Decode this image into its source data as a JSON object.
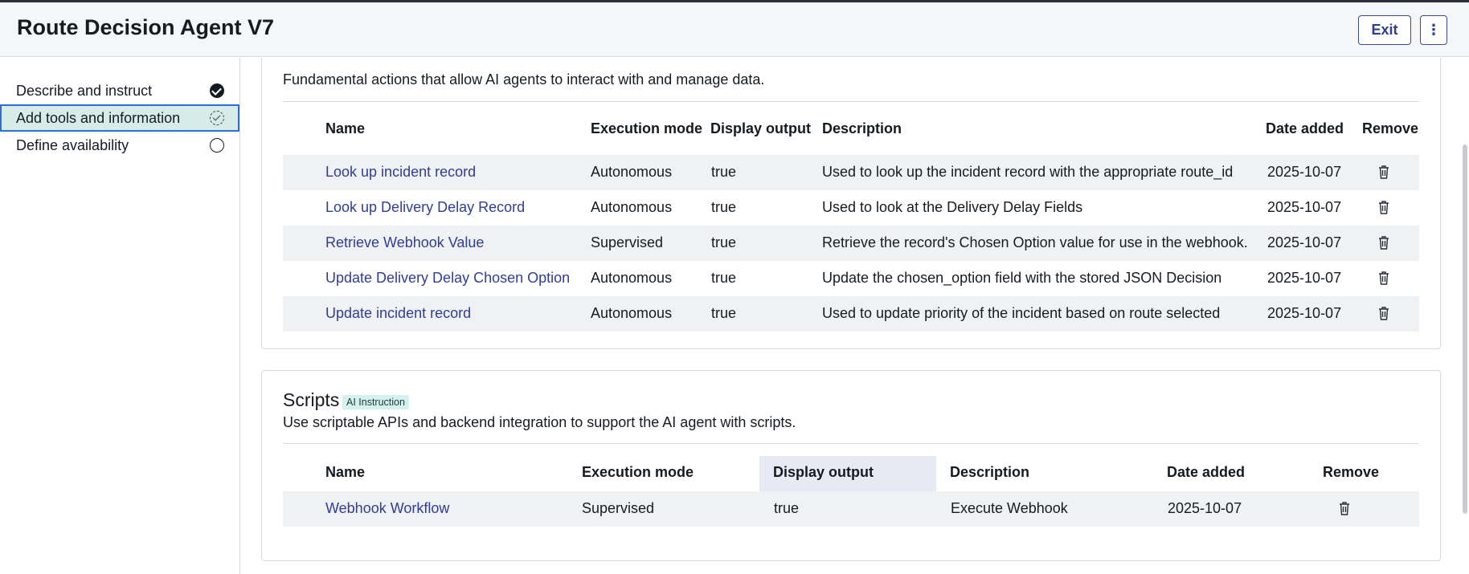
{
  "header": {
    "title": "Route Decision Agent V7",
    "exit_label": "Exit",
    "more_label": "⋮"
  },
  "sidebar": {
    "items": [
      {
        "label": "Describe and instruct",
        "status": "done"
      },
      {
        "label": "Add tools and information",
        "status": "in-progress"
      },
      {
        "label": "Define availability",
        "status": "not-started"
      }
    ]
  },
  "tools_card": {
    "description": "Fundamental actions that allow AI agents to interact with and manage data.",
    "columns": [
      "Name",
      "Execution mode",
      "Display output",
      "Description",
      "Date added",
      "Remove"
    ],
    "rows": [
      {
        "name": "Look up incident record",
        "mode": "Autonomous",
        "output": "true",
        "description": "Used to look up the incident record with the appropriate route_id",
        "date": "2025-10-07"
      },
      {
        "name": "Look up Delivery Delay Record",
        "mode": "Autonomous",
        "output": "true",
        "description": "Used to look at the Delivery Delay Fields",
        "date": "2025-10-07"
      },
      {
        "name": "Retrieve Webhook Value",
        "mode": "Supervised",
        "output": "true",
        "description": "Retrieve the record's Chosen Option value for use in the webhook.",
        "date": "2025-10-07"
      },
      {
        "name": "Update Delivery Delay Chosen Option",
        "mode": "Autonomous",
        "output": "true",
        "description": "Update the chosen_option field with the stored JSON Decision",
        "date": "2025-10-07"
      },
      {
        "name": "Update incident record",
        "mode": "Autonomous",
        "output": "true",
        "description": "Used to update priority of the incident based on route selected",
        "date": "2025-10-07"
      }
    ]
  },
  "scripts_card": {
    "title": "Scripts",
    "badge": "AI Instruction",
    "description": "Use scriptable APIs and backend integration to support the AI agent with scripts.",
    "columns": [
      "Name",
      "Execution mode",
      "Display output",
      "Description",
      "Date added",
      "Remove"
    ],
    "rows": [
      {
        "name": "Webhook Workflow",
        "mode": "Supervised",
        "output": "true",
        "description": "Execute Webhook",
        "date": "2025-10-07"
      }
    ]
  },
  "colors": {
    "link": "#2f3d9a",
    "accent": "#2c6ed1",
    "active_bg": "#d7ece9",
    "badge_bg": "#d6f0ee"
  }
}
